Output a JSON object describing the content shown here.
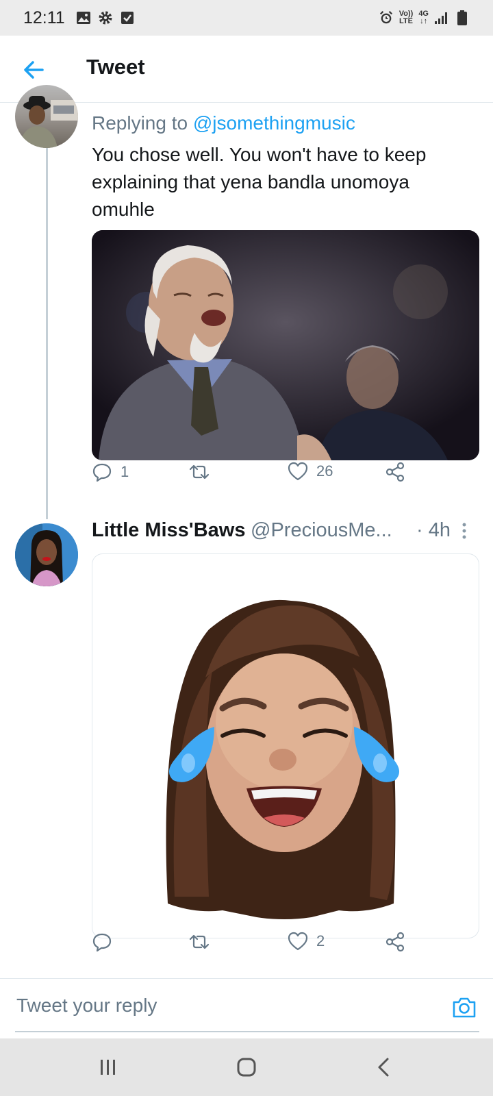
{
  "status_bar": {
    "time": "12:11",
    "network_volte": "Vo))",
    "network_lte": "LTE",
    "network_type": "4G",
    "icons": [
      "image-icon",
      "gear-icon",
      "checkbox-icon",
      "alarm-icon",
      "signal-icon",
      "battery-icon"
    ]
  },
  "app_bar": {
    "title": "Tweet"
  },
  "tweet1": {
    "replying_prefix": "Replying to",
    "replying_handle": "@jsomethingmusic",
    "text": "You chose well. You won't have to keep explaining that yena bandla unomoya omuhle",
    "replies": "1",
    "likes": "26"
  },
  "tweet2": {
    "name": "Little Miss'Baws",
    "handle": "@PreciousMe...",
    "time": "· 4h",
    "likes": "2"
  },
  "compose": {
    "placeholder": "Tweet your reply"
  },
  "colors": {
    "accent": "#1da1f2",
    "secondary_text": "#657786",
    "primary_text": "#14171a"
  }
}
